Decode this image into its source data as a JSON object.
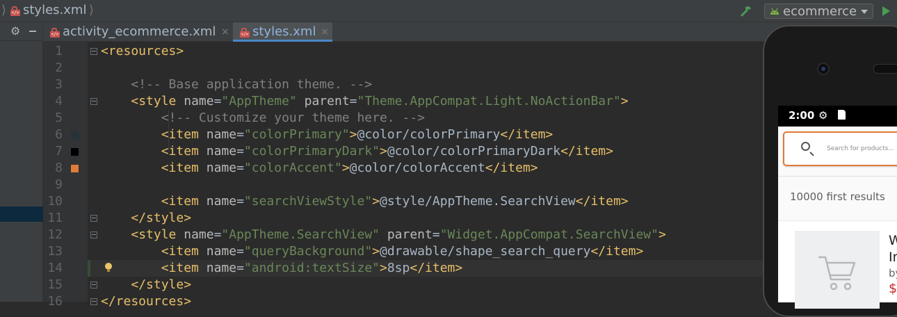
{
  "breadcrumb": {
    "file": "styles.xml"
  },
  "toolbar": {
    "run_config": "ecommerce"
  },
  "tabs": [
    {
      "label": "activity_ecommerce.xml",
      "close": "×",
      "active": false
    },
    {
      "label": "styles.xml",
      "close": "×",
      "active": true
    }
  ],
  "editor": {
    "line_numbers": [
      "1",
      "2",
      "3",
      "4",
      "5",
      "6",
      "7",
      "8",
      "9",
      "10",
      "11",
      "12",
      "13",
      "14",
      "15",
      "16"
    ],
    "lines": [
      "<resources>",
      "",
      "    <!-- Base application theme. -->",
      "    <style name=\"AppTheme\" parent=\"Theme.AppCompat.Light.NoActionBar\">",
      "        <!-- Customize your theme here. -->",
      "        <item name=\"colorPrimary\">@color/colorPrimary</item>",
      "        <item name=\"colorPrimaryDark\">@color/colorPrimaryDark</item>",
      "        <item name=\"colorAccent\">@color/colorAccent</item>",
      "",
      "        <item name=\"searchViewStyle\">@style/AppTheme.SearchView</item>",
      "    </style>",
      "    <style name=\"AppTheme.SearchView\" parent=\"Widget.AppCompat.SearchView\">",
      "        <item name=\"queryBackground\">@drawable/shape_search_query</item>",
      "        <item name=\"android:textSize\">8sp</item>",
      "    </style>",
      "</resources>"
    ],
    "color_swatches": {
      "colorPrimary": "#263238",
      "colorPrimaryDark": "#000000",
      "colorAccent": "#e07b39"
    }
  },
  "preview": {
    "status_time": "2:00",
    "search_placeholder": "Search for products...",
    "results_count": "10000 first results",
    "product_title": "W\nIn",
    "product_by": "by",
    "product_price": "$"
  }
}
